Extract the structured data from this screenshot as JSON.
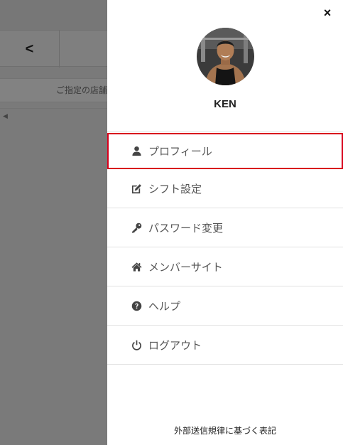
{
  "background": {
    "back_label": "<",
    "notice_text": "ご指定の店舗"
  },
  "drawer": {
    "close_label": "×",
    "user_name": "KEN",
    "menu": [
      {
        "label": "プロフィール",
        "icon": "user-icon"
      },
      {
        "label": "シフト設定",
        "icon": "edit-icon"
      },
      {
        "label": "パスワード変更",
        "icon": "key-icon"
      },
      {
        "label": "メンバーサイト",
        "icon": "home-icon"
      },
      {
        "label": "ヘルプ",
        "icon": "question-circle-icon"
      },
      {
        "label": "ログアウト",
        "icon": "power-icon"
      }
    ],
    "footer_link": "外部送信規律に基づく表記"
  },
  "colors": {
    "highlight_border": "#d8001c",
    "overlay": "#7a7a7a"
  }
}
